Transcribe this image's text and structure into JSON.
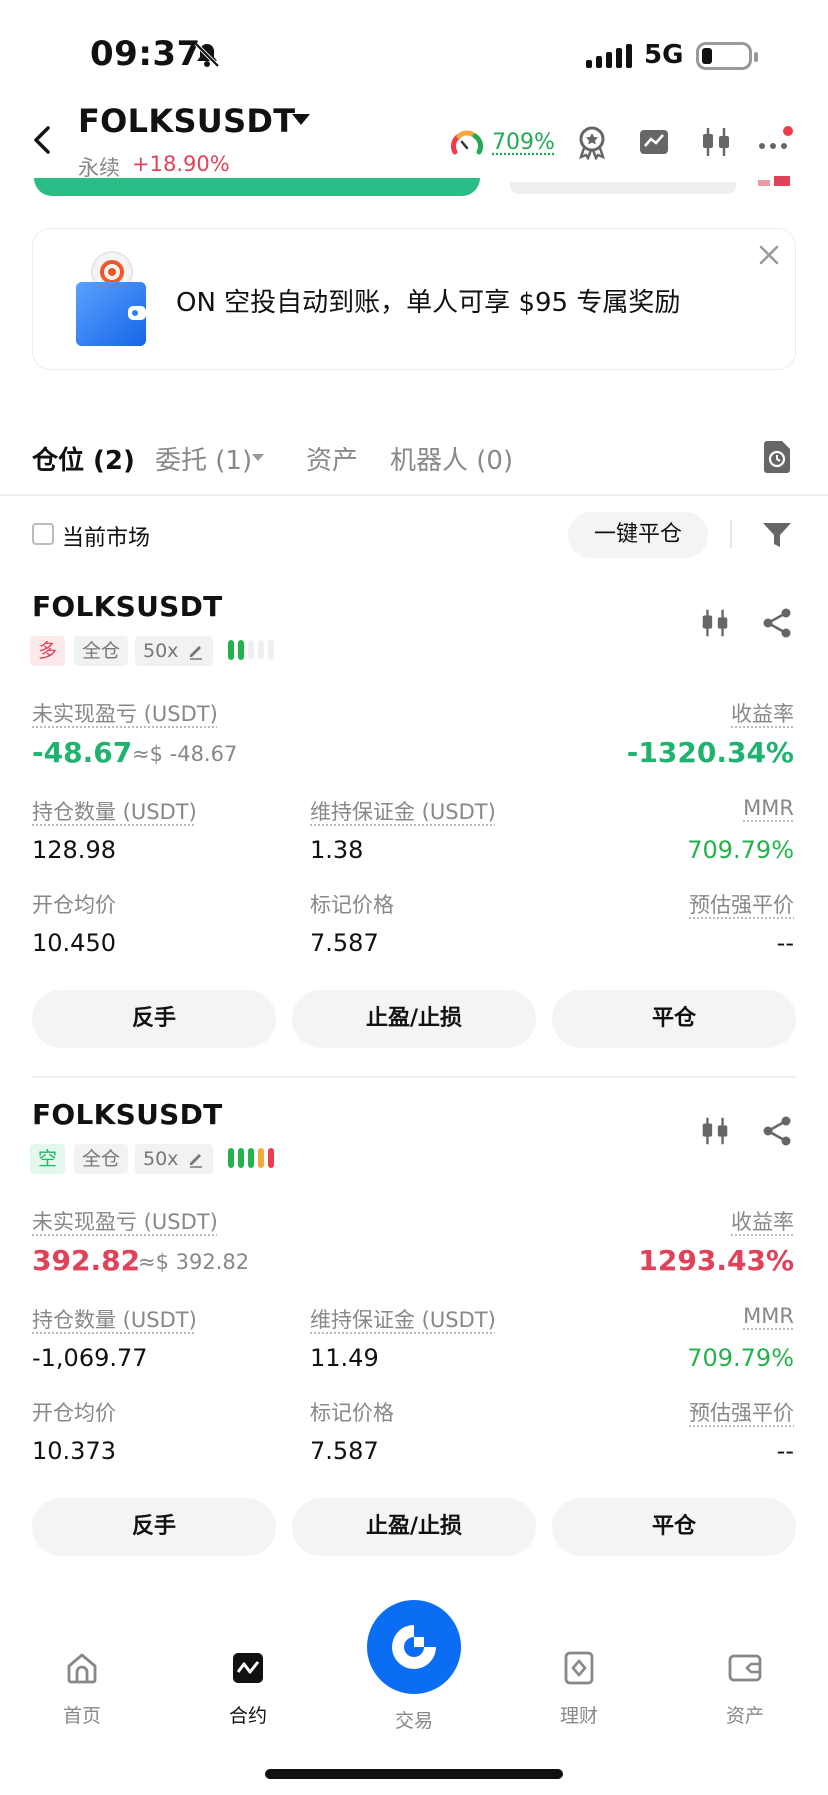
{
  "status_bar": {
    "time": "09:37",
    "network": "5G"
  },
  "header": {
    "pair": "FOLKSUSDT",
    "contract_type": "永续",
    "change": "+18.90%",
    "gauge_value": "709%"
  },
  "banner": {
    "text": "ON 空投自动到账，单人可享 $95 专属奖励"
  },
  "tabs": [
    {
      "label": "仓位 (2)"
    },
    {
      "label": "委托 (1)"
    },
    {
      "label": "资产"
    },
    {
      "label": "机器人 (0)"
    }
  ],
  "filter": {
    "current_market": "当前市场",
    "close_all": "一键平仓"
  },
  "positions": [
    {
      "symbol": "FOLKSUSDT",
      "side": "多",
      "margin_mode": "全仓",
      "leverage": "50x",
      "pnl_label": "未实现盈亏 (USDT)",
      "pnl": "-48.67",
      "pnl_usd": "≈$ -48.67",
      "roe_label": "收益率",
      "roe": "-1320.34%",
      "size_label": "持仓数量 (USDT)",
      "size": "128.98",
      "maint_label": "维持保证金 (USDT)",
      "maint": "1.38",
      "mmr_label": "MMR",
      "mmr": "709.79%",
      "entry_label": "开仓均价",
      "entry": "10.450",
      "mark_label": "标记价格",
      "mark": "7.587",
      "liq_label": "预估强平价",
      "liq": "--",
      "btn_reverse": "反手",
      "btn_tpsl": "止盈/止损",
      "btn_close": "平仓",
      "colors": {
        "pnl": "#1fb36f",
        "roe": "#1fb36f"
      }
    },
    {
      "symbol": "FOLKSUSDT",
      "side": "空",
      "margin_mode": "全仓",
      "leverage": "50x",
      "pnl_label": "未实现盈亏 (USDT)",
      "pnl": "392.82",
      "pnl_usd": "≈$ 392.82",
      "roe_label": "收益率",
      "roe": "1293.43%",
      "size_label": "持仓数量 (USDT)",
      "size": "-1,069.77",
      "maint_label": "维持保证金 (USDT)",
      "maint": "11.49",
      "mmr_label": "MMR",
      "mmr": "709.79%",
      "entry_label": "开仓均价",
      "entry": "10.373",
      "mark_label": "标记价格",
      "mark": "7.587",
      "liq_label": "预估强平价",
      "liq": "--",
      "btn_reverse": "反手",
      "btn_tpsl": "止盈/止损",
      "btn_close": "平仓",
      "colors": {
        "pnl": "#e0425a",
        "roe": "#e0425a"
      }
    }
  ],
  "bottom_nav": [
    {
      "label": "首页",
      "icon": "home-icon"
    },
    {
      "label": "合约",
      "icon": "futures-icon"
    },
    {
      "label": "交易",
      "icon": "trade-fab-icon"
    },
    {
      "label": "理财",
      "icon": "earn-icon"
    },
    {
      "label": "资产",
      "icon": "wallet-icon"
    }
  ],
  "colors": {
    "green": "#1fb36f",
    "red": "#e0425a",
    "mmr_green": "#22b34c",
    "brand_blue": "#0b6cf4"
  }
}
